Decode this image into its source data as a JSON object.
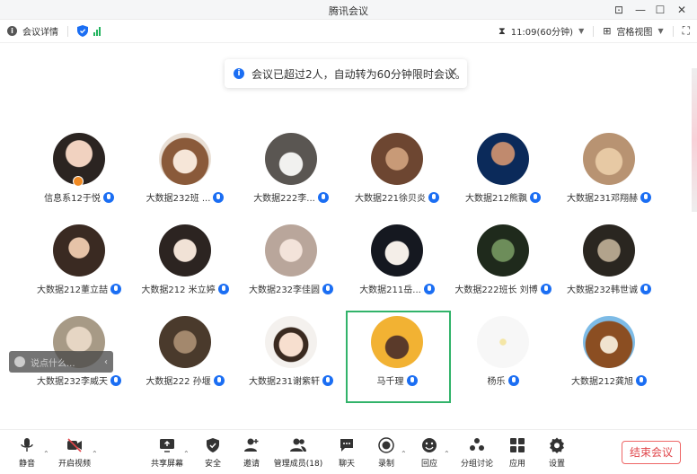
{
  "window": {
    "title": "腾讯会议"
  },
  "infobar": {
    "details": "会议详情",
    "timer": "11:09(60分钟)",
    "view": "宫格视图"
  },
  "notice": {
    "text": "会议已超过2人，自动转为60分钟限时会议。"
  },
  "participants": [
    {
      "name": "信息系12于悦"
    },
    {
      "name": "大数据232班 ..."
    },
    {
      "name": "大数据222李..."
    },
    {
      "name": "大数据221徐贝炎"
    },
    {
      "name": "大数据212熊飘"
    },
    {
      "name": "大数据231邓翔赫"
    },
    {
      "name": "大数据212董立喆"
    },
    {
      "name": "大数据212 米立婷"
    },
    {
      "name": "大数据232李佳圆"
    },
    {
      "name": "大数据211岳..."
    },
    {
      "name": "大数据222班长 刘博"
    },
    {
      "name": "大数据232韩世诚"
    },
    {
      "name": "大数据232李威天"
    },
    {
      "name": "大数据222 孙堰"
    },
    {
      "name": "大数据231谢紫轩"
    },
    {
      "name": "马千理"
    },
    {
      "name": "杨乐"
    },
    {
      "name": "大数据212龚旭"
    }
  ],
  "chat": {
    "placeholder": "说点什么..."
  },
  "toolbar": {
    "mute": "静音",
    "video": "开启视频",
    "share": "共享屏幕",
    "security": "安全",
    "invite": "邀请",
    "members": "管理成员(18)",
    "chat": "聊天",
    "record": "录制",
    "reaction": "回应",
    "breakout": "分组讨论",
    "apps": "应用",
    "settings": "设置",
    "end": "结束会议"
  },
  "colors": {
    "accent": "#1b6ef3",
    "active_border": "#32b36a",
    "end": "#e0454a"
  }
}
